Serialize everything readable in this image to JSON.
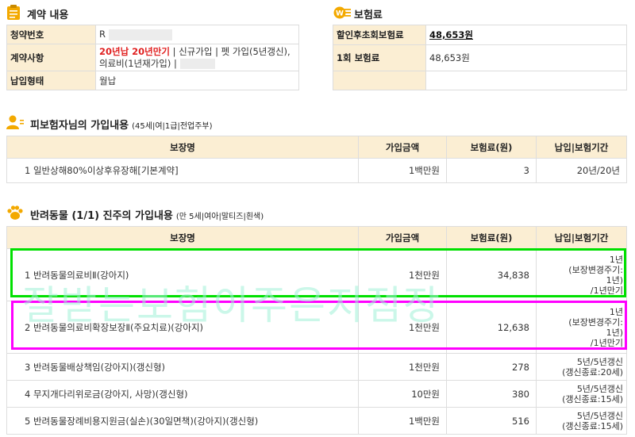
{
  "contract": {
    "title": "계약 내용",
    "rows": [
      {
        "key": "청약번호",
        "value": "R"
      },
      {
        "key": "계약사항",
        "value_red": "20년납 20년만기",
        "value_rest": " | 신규가입 | 펫 가입(5년갱신),의료비(1년재가입) |"
      },
      {
        "key": "납입형태",
        "value": "월납"
      }
    ]
  },
  "premium": {
    "title": "보험료",
    "rows": [
      {
        "key": "할인후초회보험료",
        "value": "48,653원"
      },
      {
        "key": "1회 보험료",
        "value": "48,653원"
      }
    ]
  },
  "insured": {
    "title": "피보험자님의 가입내용",
    "subtitle": "(45세|여|1급|전업주부)",
    "headers": [
      "보장명",
      "가입금액",
      "보험료(원)",
      "납입|보험기간"
    ],
    "rows": [
      {
        "name": "1  일반상해80%이상후유장해[기본계약]",
        "amount": "1백만원",
        "premium": "3",
        "period": "20년/20년"
      }
    ]
  },
  "pet": {
    "title": "반려동물 (1/1) 진주의 가입내용",
    "subtitle": "(만 5세|여아|말티즈|흰색)",
    "headers": [
      "보장명",
      "가입금액",
      "보험료(원)",
      "납입|보험기간"
    ],
    "rows": [
      {
        "name": "1  반려동물의료비Ⅱ(강아지)",
        "amount": "1천만원",
        "premium": "34,838",
        "period": [
          "1년",
          "(보장변경주기:",
          "1년)",
          "/1년만기"
        ]
      },
      {
        "name": "2  반려동물의료비확장보장Ⅱ(주요치료)(강아지)",
        "amount": "1천만원",
        "premium": "12,638",
        "period": [
          "1년",
          "(보장변경주기:",
          "1년)",
          "/1년만기"
        ]
      },
      {
        "name": "3  반려동물배상책임(강아지)(갱신형)",
        "amount": "1천만원",
        "premium": "278",
        "period": [
          "5년/5년갱신",
          "(갱신종료:20세)"
        ]
      },
      {
        "name": "4  무지개다리위로금(강아지, 사망)(갱신형)",
        "amount": "10만원",
        "premium": "380",
        "period": [
          "5년/5년갱신",
          "(갱신종료:15세)"
        ]
      },
      {
        "name": "5  반려동물장례비용지원금(실손)(30일면책)(강아지)(갱신형)",
        "amount": "1백만원",
        "premium": "516",
        "period": [
          "5년/5년갱신",
          "(갱신종료:15세)"
        ]
      }
    ]
  },
  "watermark": "잘받는보험이주은지점장",
  "colors": {
    "header_bg": "#fbeed3",
    "accent_red": "#e02020",
    "highlight_green": "#00e000",
    "highlight_pink": "#ff00ff"
  }
}
